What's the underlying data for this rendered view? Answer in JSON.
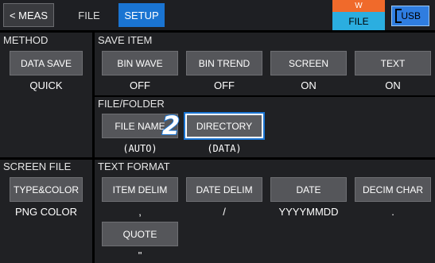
{
  "topbar": {
    "meas_label": "< MEAS",
    "file_label": "FILE",
    "setup_label": "SETUP",
    "w_label": "W",
    "wfile_label": "FILE",
    "usb_label": "USB"
  },
  "method": {
    "title": "METHOD",
    "button": "DATA SAVE",
    "value": "QUICK"
  },
  "save_item": {
    "title": "SAVE ITEM",
    "items": [
      {
        "label": "BIN WAVE",
        "value": "OFF"
      },
      {
        "label": "BIN TREND",
        "value": "OFF"
      },
      {
        "label": "SCREEN",
        "value": "ON"
      },
      {
        "label": "TEXT",
        "value": "ON"
      }
    ]
  },
  "file_folder": {
    "title": "FILE/FOLDER",
    "file_name": {
      "label": "FILE NAME",
      "value": "(AUTO)"
    },
    "directory": {
      "label": "DIRECTORY",
      "value": "(DATA)"
    },
    "callout": "2"
  },
  "screen_file": {
    "title": "SCREEN FILE",
    "button": "TYPE&COLOR",
    "value": "PNG COLOR"
  },
  "text_format": {
    "title": "TEXT FORMAT",
    "items": [
      {
        "label": "ITEM DELIM",
        "value": ","
      },
      {
        "label": "DATE DELIM",
        "value": "/"
      },
      {
        "label": "DATE",
        "value": "YYYYMMDD"
      },
      {
        "label": "DECIM CHAR",
        "value": "."
      }
    ],
    "quote": {
      "label": "QUOTE",
      "value": "\""
    }
  },
  "colors": {
    "setup_tab": "#1a74d2",
    "w_badge": "#f06a2b",
    "file_badge": "#2baee0",
    "usb": "#2f7de0"
  }
}
